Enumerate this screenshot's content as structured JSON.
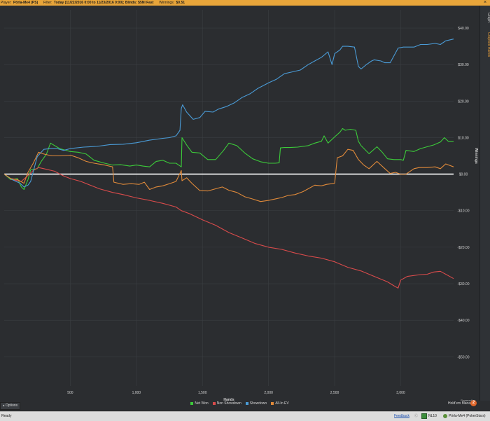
{
  "header": {
    "player_label": "Player:",
    "player_value": "Pörla-Me4 (PS)",
    "filter_label": "Filter:",
    "filter_value": "Today (11/22/2016 0:00 to 11/23/2016 0:00); Blinds: $5Nl Fast",
    "winnings_label": "Winnings:",
    "winnings_value": "$0.51",
    "close_glyph": "×"
  },
  "sidebar": {
    "tabs": [
      {
        "label": "Graph"
      },
      {
        "label": "Graphed Hands"
      }
    ]
  },
  "options_button": {
    "label": "Options"
  },
  "brand": {
    "line1": "Powered by",
    "line2": "Hold'em Manager",
    "logo": "2"
  },
  "status": {
    "ready": "Ready",
    "feedback": "Feedback",
    "sep": "Ⓒ",
    "table": "NL10",
    "player": "Pörla-Me4 (PokerStars)"
  },
  "chart_data": {
    "type": "line",
    "xlabel": "Hands",
    "ylabel": "Winnings",
    "xlim": [
      0,
      3400
    ],
    "ylim": [
      -58,
      45
    ],
    "x_ticks": [
      500,
      1000,
      1500,
      2000,
      2500,
      3000
    ],
    "x_tick_labels": [
      "500",
      "1,000",
      "1,500",
      "2,000",
      "2,500",
      "3,000"
    ],
    "y_ticks": [
      40,
      30,
      20,
      10,
      0,
      -10,
      -20,
      -30,
      -40,
      -50
    ],
    "y_tick_labels": [
      "$40.00",
      "$30.00",
      "$20.00",
      "$10.00",
      "$0.00",
      "-$10.00",
      "-$20.00",
      "-$30.00",
      "-$40.00",
      "-$50.00"
    ],
    "grid": true,
    "zero_line_color": "#ffffff",
    "legend_position": "bottom-center",
    "series": [
      {
        "name": "Net Won",
        "color": "#3ccb3a",
        "points": [
          [
            0,
            0
          ],
          [
            50,
            -1.5
          ],
          [
            100,
            -1.2
          ],
          [
            130,
            -3.5
          ],
          [
            150,
            -4.2
          ],
          [
            180,
            -1.5
          ],
          [
            200,
            1.2
          ],
          [
            250,
            1.5
          ],
          [
            280,
            3.5
          ],
          [
            320,
            5.5
          ],
          [
            350,
            8.5
          ],
          [
            420,
            7.0
          ],
          [
            500,
            6.2
          ],
          [
            560,
            6.0
          ],
          [
            620,
            5.5
          ],
          [
            680,
            3.8
          ],
          [
            760,
            3.0
          ],
          [
            820,
            2.5
          ],
          [
            880,
            2.6
          ],
          [
            950,
            2.2
          ],
          [
            1000,
            2.5
          ],
          [
            1050,
            2.2
          ],
          [
            1100,
            2.0
          ],
          [
            1150,
            3.5
          ],
          [
            1200,
            3.8
          ],
          [
            1250,
            3.0
          ],
          [
            1300,
            3.0
          ],
          [
            1340,
            2.0
          ],
          [
            1345,
            10.0
          ],
          [
            1380,
            8.0
          ],
          [
            1420,
            6.0
          ],
          [
            1480,
            5.8
          ],
          [
            1540,
            4.0
          ],
          [
            1600,
            4.0
          ],
          [
            1660,
            6.5
          ],
          [
            1700,
            8.5
          ],
          [
            1760,
            7.8
          ],
          [
            1820,
            5.8
          ],
          [
            1880,
            4.2
          ],
          [
            1940,
            3.4
          ],
          [
            2000,
            3.0
          ],
          [
            2050,
            3.0
          ],
          [
            2080,
            3.1
          ],
          [
            2090,
            7.2
          ],
          [
            2120,
            7.3
          ],
          [
            2160,
            7.3
          ],
          [
            2220,
            7.4
          ],
          [
            2300,
            7.8
          ],
          [
            2350,
            8.5
          ],
          [
            2400,
            9.0
          ],
          [
            2420,
            10.5
          ],
          [
            2450,
            8.5
          ],
          [
            2500,
            10.2
          ],
          [
            2540,
            11.5
          ],
          [
            2560,
            12.5
          ],
          [
            2580,
            12.0
          ],
          [
            2620,
            12.3
          ],
          [
            2660,
            12.0
          ],
          [
            2680,
            9.0
          ],
          [
            2700,
            7.8
          ],
          [
            2760,
            5.6
          ],
          [
            2820,
            7.5
          ],
          [
            2860,
            6.0
          ],
          [
            2900,
            4.2
          ],
          [
            2950,
            4.0
          ],
          [
            3000,
            4.0
          ],
          [
            3020,
            3.8
          ],
          [
            3040,
            6.5
          ],
          [
            3100,
            6.2
          ],
          [
            3150,
            7.0
          ],
          [
            3200,
            7.5
          ],
          [
            3250,
            8.0
          ],
          [
            3300,
            8.8
          ],
          [
            3330,
            10.0
          ],
          [
            3360,
            9.0
          ],
          [
            3400,
            9.0
          ]
        ]
      },
      {
        "name": "Non Showdown",
        "color": "#d94b4b",
        "points": [
          [
            0,
            0
          ],
          [
            60,
            -1.5
          ],
          [
            130,
            -2.0
          ],
          [
            190,
            0.0
          ],
          [
            220,
            1.0
          ],
          [
            260,
            1.8
          ],
          [
            300,
            1.5
          ],
          [
            380,
            0.8
          ],
          [
            450,
            -0.5
          ],
          [
            500,
            -1.2
          ],
          [
            580,
            -2.0
          ],
          [
            650,
            -3.0
          ],
          [
            720,
            -4.0
          ],
          [
            820,
            -5.0
          ],
          [
            900,
            -5.6
          ],
          [
            1000,
            -6.5
          ],
          [
            1100,
            -7.2
          ],
          [
            1200,
            -8.0
          ],
          [
            1300,
            -9.0
          ],
          [
            1340,
            -10.0
          ],
          [
            1400,
            -10.8
          ],
          [
            1500,
            -12.5
          ],
          [
            1600,
            -14.0
          ],
          [
            1700,
            -16.0
          ],
          [
            1800,
            -17.5
          ],
          [
            1900,
            -19.0
          ],
          [
            2000,
            -20.0
          ],
          [
            2100,
            -20.6
          ],
          [
            2200,
            -21.6
          ],
          [
            2300,
            -22.4
          ],
          [
            2400,
            -23.0
          ],
          [
            2500,
            -24.0
          ],
          [
            2600,
            -25.5
          ],
          [
            2700,
            -26.5
          ],
          [
            2800,
            -28.0
          ],
          [
            2900,
            -29.5
          ],
          [
            2950,
            -30.6
          ],
          [
            2980,
            -31.2
          ],
          [
            3000,
            -29.0
          ],
          [
            3050,
            -28.0
          ],
          [
            3150,
            -27.5
          ],
          [
            3200,
            -27.4
          ],
          [
            3250,
            -26.8
          ],
          [
            3300,
            -26.6
          ],
          [
            3400,
            -28.6
          ]
        ]
      },
      {
        "name": "Showdown",
        "color": "#4a9bd6",
        "points": [
          [
            0,
            0
          ],
          [
            60,
            -1.5
          ],
          [
            120,
            -2.5
          ],
          [
            150,
            -3.5
          ],
          [
            180,
            -3.0
          ],
          [
            200,
            -2.0
          ],
          [
            250,
            4.8
          ],
          [
            300,
            6.8
          ],
          [
            350,
            7.0
          ],
          [
            400,
            7.0
          ],
          [
            450,
            6.5
          ],
          [
            500,
            7.0
          ],
          [
            600,
            7.4
          ],
          [
            700,
            7.6
          ],
          [
            800,
            8.1
          ],
          [
            900,
            8.2
          ],
          [
            1000,
            8.6
          ],
          [
            1100,
            9.3
          ],
          [
            1200,
            9.8
          ],
          [
            1250,
            10.0
          ],
          [
            1300,
            10.5
          ],
          [
            1330,
            12.0
          ],
          [
            1340,
            18.0
          ],
          [
            1350,
            19.0
          ],
          [
            1380,
            17.0
          ],
          [
            1430,
            15.0
          ],
          [
            1480,
            15.5
          ],
          [
            1520,
            17.2
          ],
          [
            1580,
            17.0
          ],
          [
            1620,
            17.8
          ],
          [
            1680,
            18.5
          ],
          [
            1740,
            19.5
          ],
          [
            1800,
            21.0
          ],
          [
            1860,
            22.0
          ],
          [
            1920,
            23.5
          ],
          [
            2000,
            25.0
          ],
          [
            2060,
            26.0
          ],
          [
            2120,
            27.5
          ],
          [
            2180,
            28.0
          ],
          [
            2240,
            28.5
          ],
          [
            2300,
            30.0
          ],
          [
            2350,
            31.0
          ],
          [
            2400,
            32.0
          ],
          [
            2450,
            33.5
          ],
          [
            2480,
            30.0
          ],
          [
            2500,
            33.0
          ],
          [
            2540,
            34.0
          ],
          [
            2560,
            35.0
          ],
          [
            2600,
            35.0
          ],
          [
            2650,
            34.8
          ],
          [
            2680,
            29.5
          ],
          [
            2700,
            28.8
          ],
          [
            2740,
            30.0
          ],
          [
            2780,
            31.0
          ],
          [
            2800,
            31.3
          ],
          [
            2850,
            31.0
          ],
          [
            2880,
            30.5
          ],
          [
            2920,
            30.5
          ],
          [
            2980,
            34.5
          ],
          [
            3020,
            34.8
          ],
          [
            3100,
            34.8
          ],
          [
            3150,
            35.5
          ],
          [
            3200,
            35.5
          ],
          [
            3260,
            35.8
          ],
          [
            3300,
            35.5
          ],
          [
            3340,
            36.5
          ],
          [
            3400,
            37.0
          ]
        ]
      },
      {
        "name": "All-In EV",
        "color": "#e08a3a",
        "points": [
          [
            0,
            0
          ],
          [
            50,
            -1.2
          ],
          [
            100,
            -1.5
          ],
          [
            150,
            -2.5
          ],
          [
            180,
            0.5
          ],
          [
            220,
            3.0
          ],
          [
            260,
            6.0
          ],
          [
            300,
            5.5
          ],
          [
            360,
            5.0
          ],
          [
            420,
            5.0
          ],
          [
            500,
            5.2
          ],
          [
            560,
            4.5
          ],
          [
            620,
            3.5
          ],
          [
            680,
            3.0
          ],
          [
            760,
            2.5
          ],
          [
            820,
            2.0
          ],
          [
            830,
            -2.2
          ],
          [
            900,
            -2.8
          ],
          [
            960,
            -2.6
          ],
          [
            1020,
            -2.8
          ],
          [
            1060,
            -2.2
          ],
          [
            1100,
            -4.2
          ],
          [
            1150,
            -3.5
          ],
          [
            1200,
            -3.2
          ],
          [
            1260,
            -2.5
          ],
          [
            1300,
            -2.0
          ],
          [
            1340,
            1.0
          ],
          [
            1345,
            -1.8
          ],
          [
            1380,
            -1.0
          ],
          [
            1420,
            -2.5
          ],
          [
            1480,
            -4.5
          ],
          [
            1540,
            -4.6
          ],
          [
            1600,
            -4.0
          ],
          [
            1650,
            -3.5
          ],
          [
            1700,
            -4.4
          ],
          [
            1760,
            -5.0
          ],
          [
            1820,
            -6.2
          ],
          [
            1880,
            -6.8
          ],
          [
            1940,
            -7.5
          ],
          [
            2000,
            -7.2
          ],
          [
            2050,
            -6.8
          ],
          [
            2100,
            -6.4
          ],
          [
            2150,
            -5.8
          ],
          [
            2200,
            -5.6
          ],
          [
            2260,
            -4.8
          ],
          [
            2300,
            -4.0
          ],
          [
            2350,
            -3.0
          ],
          [
            2400,
            -3.2
          ],
          [
            2440,
            -2.8
          ],
          [
            2480,
            -2.6
          ],
          [
            2500,
            -2.5
          ],
          [
            2520,
            4.5
          ],
          [
            2560,
            5.0
          ],
          [
            2600,
            6.8
          ],
          [
            2640,
            6.5
          ],
          [
            2680,
            4.0
          ],
          [
            2720,
            2.5
          ],
          [
            2760,
            1.5
          ],
          [
            2820,
            3.5
          ],
          [
            2880,
            1.5
          ],
          [
            2920,
            0.2
          ],
          [
            2960,
            0.5
          ],
          [
            3000,
            0.0
          ],
          [
            3040,
            0.0
          ],
          [
            3100,
            1.5
          ],
          [
            3140,
            1.8
          ],
          [
            3200,
            1.8
          ],
          [
            3260,
            2.0
          ],
          [
            3300,
            1.5
          ],
          [
            3340,
            2.8
          ],
          [
            3400,
            2.0
          ]
        ]
      }
    ]
  }
}
